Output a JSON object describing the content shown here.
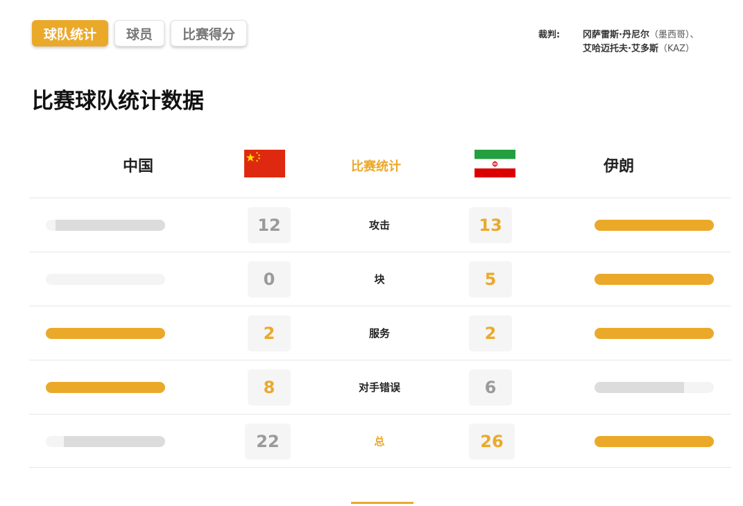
{
  "tabs": [
    {
      "label": "球队统计",
      "active": true
    },
    {
      "label": "球员",
      "active": false
    },
    {
      "label": "比赛得分",
      "active": false
    }
  ],
  "referee": {
    "label": "裁判:",
    "line1_name": "冈萨雷斯·丹尼尔",
    "line1_paren": "（墨西哥）、",
    "line2_name": "艾哈迈托夫·艾多斯",
    "line2_paren": "（KAZ）"
  },
  "page_title": "比赛球队统计数据",
  "header": {
    "home_team": "中国",
    "away_team": "伊朗",
    "center_title": "比赛统计",
    "home_flag_icon": "china-flag-icon",
    "away_flag_icon": "iran-flag-icon"
  },
  "colors": {
    "accent": "#eba92a",
    "bar_track": "#f4f4f4",
    "bar_fill_neutral": "#dcdcdc",
    "number_neutral": "#9a9a9a"
  },
  "stats": [
    {
      "label": "攻击",
      "home": "12",
      "away": "13",
      "home_share": 0.92,
      "away_share": 1.0,
      "leader": "away"
    },
    {
      "label": "块",
      "home": "0",
      "away": "5",
      "home_share": 0.0,
      "away_share": 1.0,
      "leader": "away"
    },
    {
      "label": "服务",
      "home": "2",
      "away": "2",
      "home_share": 1.0,
      "away_share": 1.0,
      "leader": "both"
    },
    {
      "label": "对手错误",
      "home": "8",
      "away": "6",
      "home_share": 1.0,
      "away_share": 0.75,
      "leader": "home"
    },
    {
      "label": "总",
      "home": "22",
      "away": "26",
      "home_share": 0.85,
      "away_share": 1.0,
      "leader": "away",
      "total": true
    }
  ]
}
